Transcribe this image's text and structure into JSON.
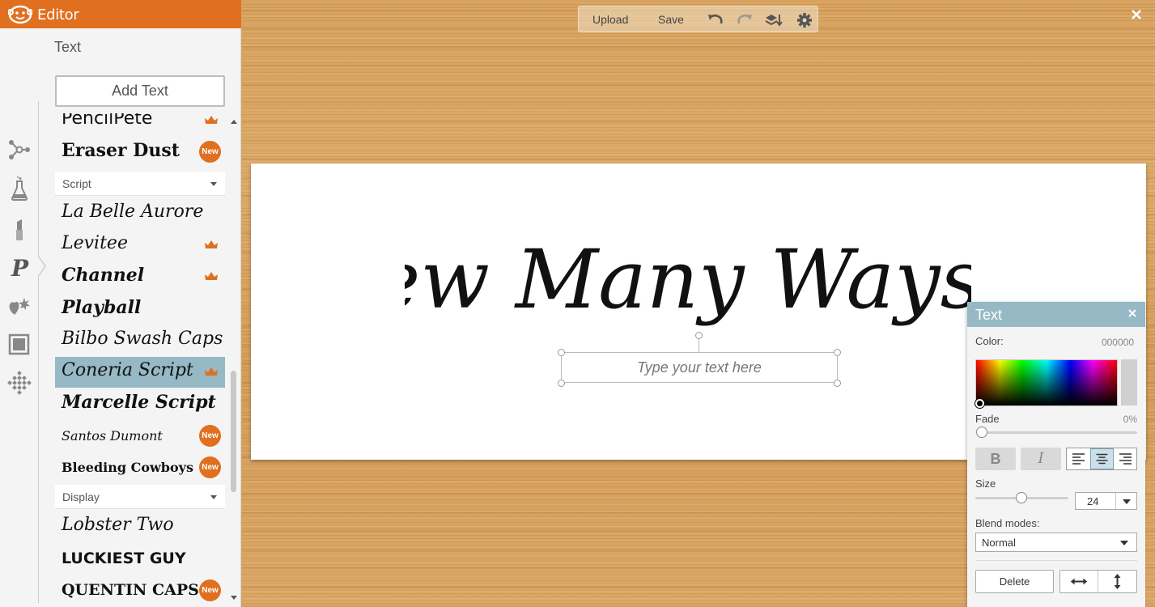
{
  "app": {
    "title": "Editor"
  },
  "sidebar": {
    "section_title": "Text",
    "add_text_label": "Add Text",
    "rail_icons": [
      "edit-nodes-icon",
      "effects-flask-icon",
      "touch-up-lipstick-icon",
      "text-p-icon",
      "overlays-icon",
      "frames-icon",
      "textures-icon"
    ],
    "fonts_top": [
      {
        "name": "PencilPete",
        "badge": "crown",
        "font": "DejaVu Sans",
        "style": "normal"
      },
      {
        "name": "Eraser Dust",
        "badge": "new",
        "font": "DejaVu Serif",
        "style": "bold"
      }
    ],
    "categories": {
      "script": "Script",
      "display": "Display"
    },
    "fonts_script": [
      {
        "name": "La Belle Aurore",
        "badge": "",
        "font": "DejaVu Serif",
        "style": "italic"
      },
      {
        "name": "Levitee",
        "badge": "crown",
        "font": "DejaVu Serif",
        "style": "italic"
      },
      {
        "name": "Channel",
        "badge": "crown",
        "font": "DejaVu Serif",
        "style": "bolditalic"
      },
      {
        "name": "Playball",
        "badge": "",
        "font": "DejaVu Serif",
        "style": "bolditalic"
      },
      {
        "name": "Bilbo Swash Caps",
        "badge": "",
        "font": "DejaVu Serif",
        "style": "italic"
      },
      {
        "name": "Coneria Script",
        "badge": "crown",
        "font": "DejaVu Serif",
        "style": "italic",
        "selected": true
      },
      {
        "name": "Marcelle Script",
        "badge": "",
        "font": "DejaVu Serif",
        "style": "bolditalic"
      },
      {
        "name": "Santos Dumont",
        "badge": "new",
        "font": "DejaVu Serif",
        "style": "italic"
      },
      {
        "name": "Bleeding Cowboys",
        "badge": "new",
        "font": "DejaVu Serif",
        "style": "bold"
      }
    ],
    "fonts_display": [
      {
        "name": "Lobster Two",
        "badge": "",
        "font": "DejaVu Serif",
        "style": "italic"
      },
      {
        "name": "Luckiest Guy",
        "badge": "",
        "font": "DejaVu Sans",
        "style": "bold"
      },
      {
        "name": "Quentin Caps",
        "badge": "new",
        "font": "DejaVu Serif",
        "style": "bold"
      }
    ],
    "new_badge_label": "New"
  },
  "toolbar": {
    "upload_label": "Upload",
    "save_label": "Save",
    "icons": [
      "undo-icon",
      "redo-icon",
      "layers-icon",
      "settings-gear-icon"
    ]
  },
  "canvas": {
    "headline": "Sew Many Ways...",
    "text_placeholder": "Type your text here"
  },
  "text_panel": {
    "title": "Text",
    "color_label": "Color:",
    "color_value": "000000",
    "fade_label": "Fade",
    "fade_value": "0%",
    "fade_fraction": 0,
    "bold_label": "B",
    "italic_label": "I",
    "alignment": "center",
    "size_label": "Size",
    "size_value": "24",
    "blend_label": "Blend modes:",
    "blend_value": "Normal",
    "delete_label": "Delete",
    "colors": {
      "header": "#96b9c5",
      "accent": "#e0701f"
    }
  }
}
